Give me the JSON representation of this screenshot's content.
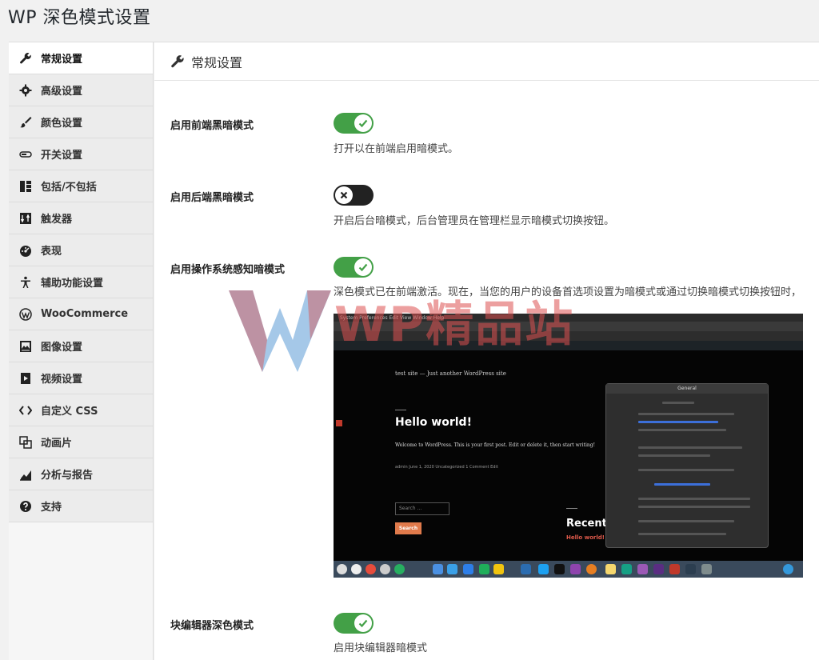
{
  "page": {
    "title": "WP 深色模式设置"
  },
  "sidebar": {
    "items": [
      {
        "label": "常规设置",
        "icon": "wrench-icon",
        "active": true
      },
      {
        "label": "高级设置",
        "icon": "gear-icon",
        "active": false
      },
      {
        "label": "颜色设置",
        "icon": "brush-icon",
        "active": false
      },
      {
        "label": "开关设置",
        "icon": "toggle-icon",
        "active": false
      },
      {
        "label": "包括/不包括",
        "icon": "columns-icon",
        "active": false
      },
      {
        "label": "触发器",
        "icon": "trigger-icon",
        "active": false
      },
      {
        "label": "表现",
        "icon": "dashboard-icon",
        "active": false
      },
      {
        "label": "辅助功能设置",
        "icon": "accessibility-icon",
        "active": false
      },
      {
        "label": "WooCommerce",
        "icon": "wordpress-icon",
        "active": false
      },
      {
        "label": "图像设置",
        "icon": "image-icon",
        "active": false
      },
      {
        "label": "视频设置",
        "icon": "video-icon",
        "active": false
      },
      {
        "label": "自定义 CSS",
        "icon": "code-icon",
        "active": false
      },
      {
        "label": "动画片",
        "icon": "animation-icon",
        "active": false
      },
      {
        "label": "分析与报告",
        "icon": "chart-icon",
        "active": false
      },
      {
        "label": "支持",
        "icon": "help-icon",
        "active": false
      }
    ]
  },
  "main": {
    "section_title": "常规设置",
    "section_icon": "wrench-icon",
    "rows": [
      {
        "label": "启用前端黑暗模式",
        "enabled": true,
        "description": "打开以在前端启用暗模式。"
      },
      {
        "label": "启用后端黑暗模式",
        "enabled": false,
        "description": "开启后台暗模式，后台管理员在管理栏显示暗模式切换按钮。"
      },
      {
        "label": "启用操作系统感知暗模式",
        "enabled": true,
        "description": "深色模式已在前端激活。现在，当您的用户的设备首选项设置为暗模式或通过切换暗模式切换按钮时，"
      },
      {
        "label": "块编辑器深色模式",
        "enabled": true,
        "description": "启用块编辑器暗模式"
      }
    ]
  },
  "preview": {
    "site_tagline": "test site — Just another WordPress site",
    "post_title": "Hello world!",
    "post_body": "Welcome to WordPress. This is your first post. Edit or delete it, then start writing!",
    "post_meta": "admin   June 1, 2020   Uncategorized   1 Comment   Edit",
    "search_placeholder": "Search ...",
    "search_button": "Search",
    "recent_heading": "Recent",
    "recent_link": "Hello world!",
    "prefs_title": "General",
    "mac_menu": "System Preferences  Edit  View  Window  Help"
  },
  "watermark": {
    "text": "WP精品站"
  },
  "colors": {
    "toggle_on": "#43a047",
    "toggle_off": "#222222",
    "watermark_red": "#dc5050",
    "watermark_blue": "#5b9bd5"
  }
}
